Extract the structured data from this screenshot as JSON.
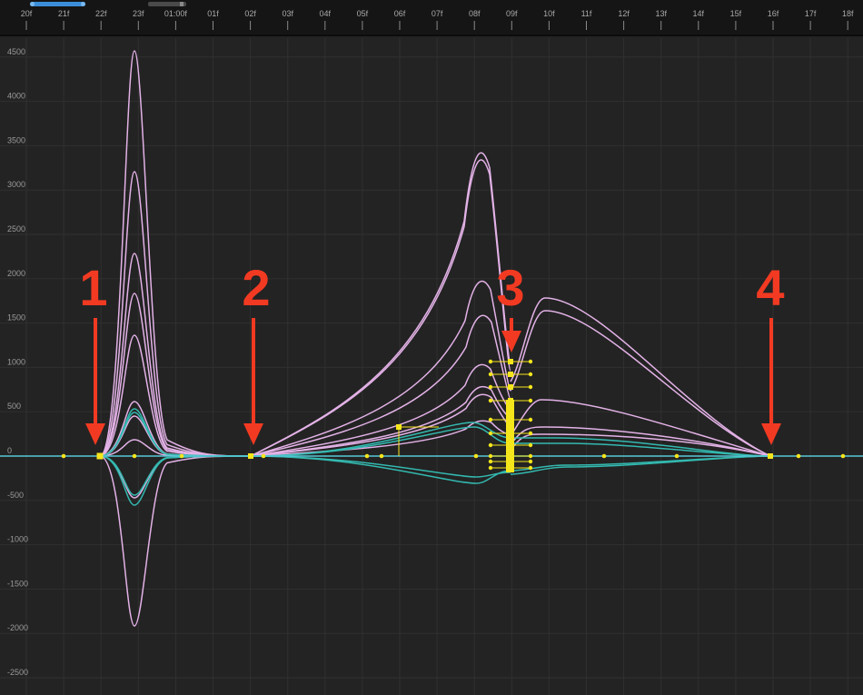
{
  "timeline": {
    "frame_labels": [
      "20f",
      "21f",
      "22f",
      "23f",
      "01:00f",
      "01f",
      "02f",
      "03f",
      "04f",
      "05f",
      "06f",
      "07f",
      "08f",
      "09f",
      "10f",
      "11f",
      "12f",
      "13f",
      "14f",
      "15f",
      "16f",
      "17f",
      "18f"
    ],
    "work_area_color": "#3b8ed8",
    "playhead_color": "#5a5a5a"
  },
  "graph": {
    "y_axis_labels": [
      "4500",
      "4000",
      "3500",
      "3000",
      "2500",
      "2000",
      "1500",
      "1000",
      "500",
      "0",
      "-500",
      "-1000",
      "-1500",
      "-2000",
      "-2500"
    ],
    "y_values": [
      4500,
      4000,
      3500,
      3000,
      2500,
      2000,
      1500,
      1000,
      500,
      0,
      -500,
      -1000,
      -1500,
      -2000,
      -2500
    ],
    "background": "#232323",
    "grid_color": "#2f2f2f",
    "curve_colors": {
      "pink": "#e3b2e7",
      "teal": "#33b9b0",
      "baseline": "#58c8d8",
      "keyframe": "#f5e61c"
    }
  },
  "annotations": {
    "labels": [
      "1",
      "2",
      "3",
      "4"
    ],
    "color": "#f23a22"
  }
}
